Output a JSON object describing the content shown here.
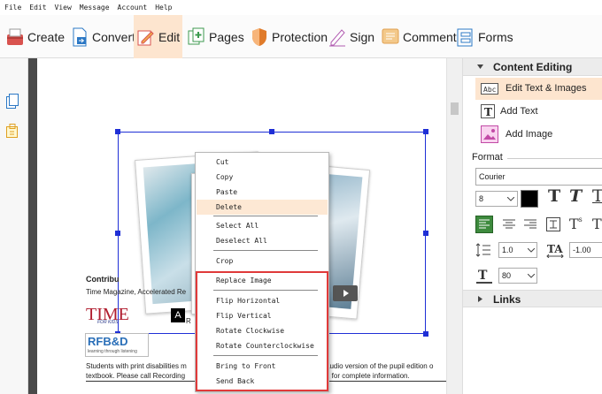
{
  "menubar": [
    "File",
    "Edit",
    "View",
    "Message",
    "Account",
    "Help"
  ],
  "toolbar": {
    "create": "Create",
    "convert": "Convert",
    "edit": "Edit",
    "pages": "Pages",
    "protection": "Protection",
    "sign": "Sign",
    "comment": "Comment",
    "forms": "Forms"
  },
  "context_menu": {
    "items": [
      "Cut",
      "Copy",
      "Paste",
      "Delete",
      "Select All",
      "Deselect All",
      "Crop",
      "Replace Image",
      "Flip Horizontal",
      "Flip Vertical",
      "Rotate Clockwise",
      "Rotate Counterclockwise",
      "Bring to Front",
      "Send Back"
    ],
    "highlighted": "Delete"
  },
  "document": {
    "contrib_heading": "Contribu",
    "contrib_line": "Time Magazine, Accelerated Re",
    "time_logo": "TIME",
    "time_sub": "FOR KIDS",
    "rfbd": "RFB&D",
    "rfbd_sub": "learning through listening",
    "ar_logo": "A",
    "ar_logo2": "R",
    "footer_line1_left": "Students with print disabilities m",
    "footer_line1_right": "audio version of the pupil edition o",
    "footer_line2_left": "textbook. Please call Recording",
    "footer_line2_right": "2 for complete information."
  },
  "right_panel": {
    "section": "Content Editing",
    "edit_text_images": "Edit Text & Images",
    "add_text": "Add Text",
    "add_image": "Add Image",
    "format": "Format",
    "font": "Courier",
    "font_size": "8",
    "line_spacing": "1.0",
    "char_spacing": "-1.00",
    "scale": "80",
    "links": "Links"
  },
  "colors": {
    "accent": "#f5a15c",
    "selection_handle": "#1f2fd6",
    "menu_highlight": "#fde8d4",
    "red_box": "#e03a3a"
  }
}
